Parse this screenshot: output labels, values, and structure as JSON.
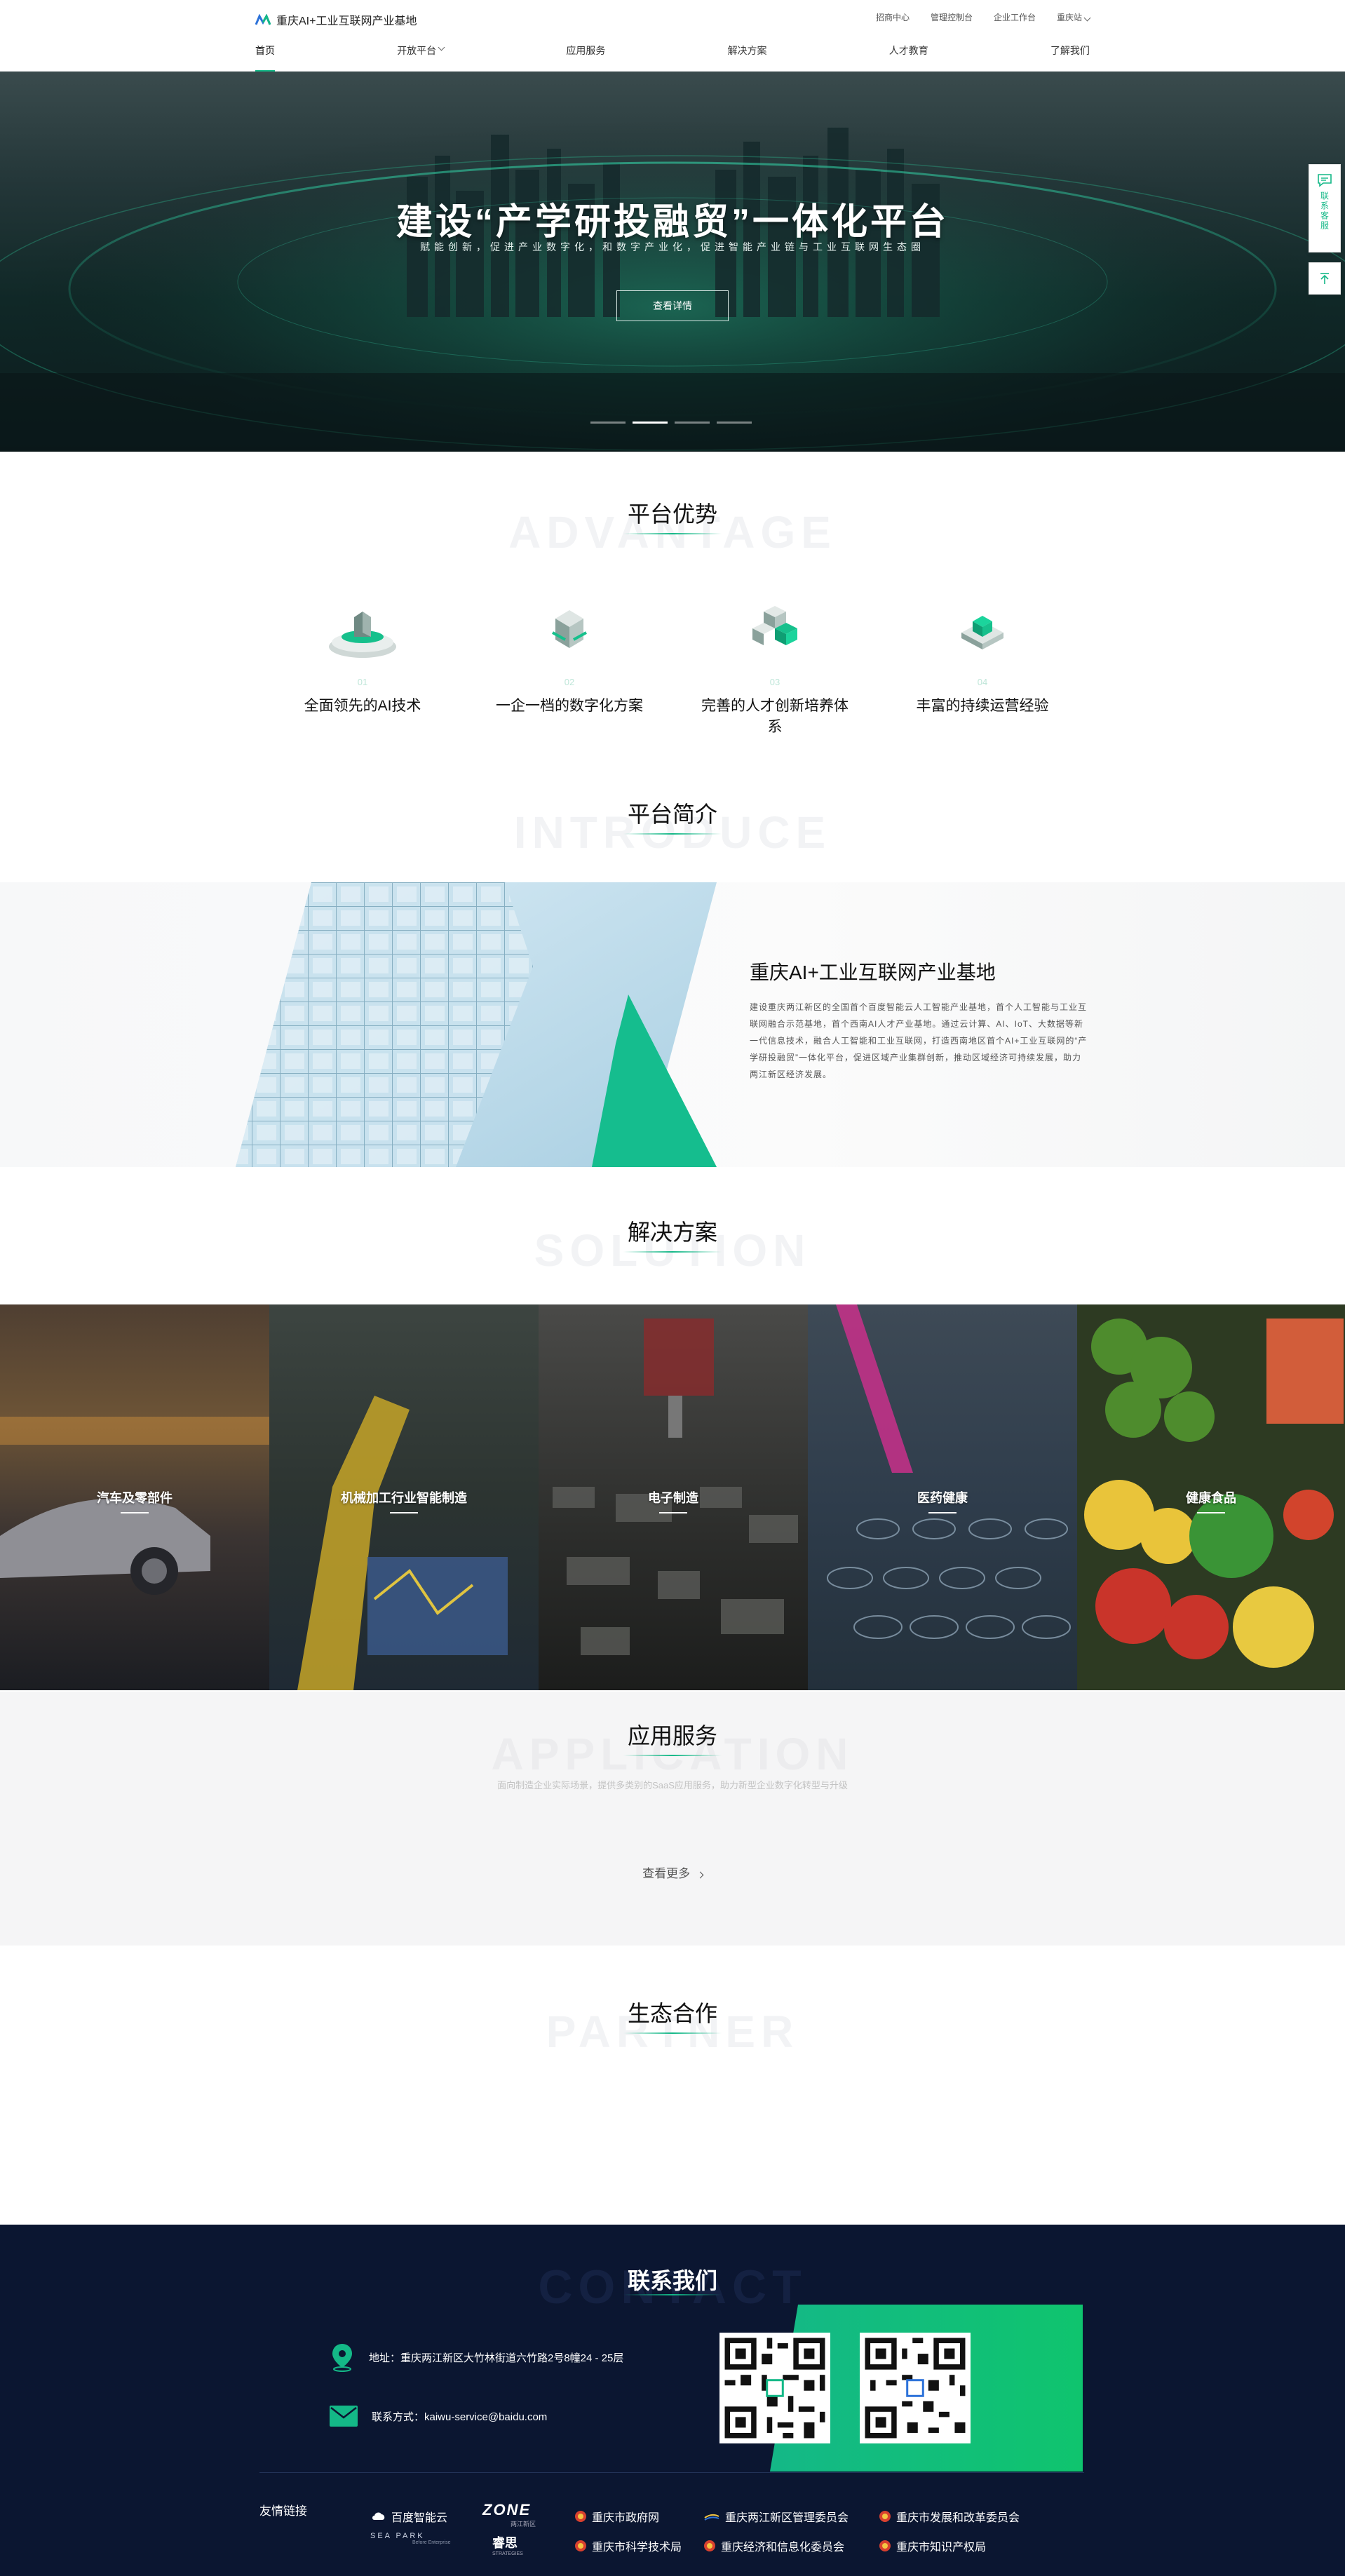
{
  "header": {
    "logo_text": "重庆AI+工业互联网产业基地",
    "top_links": [
      "招商中心",
      "管理控制台",
      "企业工作台",
      "重庆站"
    ],
    "nav": [
      {
        "label": "首页",
        "active": true
      },
      {
        "label": "开放平台",
        "has_dropdown": true
      },
      {
        "label": "应用服务"
      },
      {
        "label": "解决方案"
      },
      {
        "label": "人才教育"
      },
      {
        "label": "了解我们"
      }
    ]
  },
  "hero": {
    "title": "建设“产学研投融贸”一体化平台",
    "subtitle": "赋能创新，促进产业数字化，和数字产业化，促进智能产业链与工业互联网生态圈",
    "button": "查看详情",
    "slides": 4,
    "active_slide": 2
  },
  "float": {
    "service_label": "联系客服",
    "icons": [
      "chat-icon",
      "back-to-top-icon"
    ]
  },
  "advantage": {
    "title": "平台优势",
    "bg_text": "ADVANTAGE",
    "items": [
      {
        "num": "01",
        "label": "全面领先的AI技术"
      },
      {
        "num": "02",
        "label": "一企一档的数字化方案"
      },
      {
        "num": "03",
        "label": "完善的人才创新培养体系"
      },
      {
        "num": "04",
        "label": "丰富的持续运营经验"
      }
    ]
  },
  "intro": {
    "title": "平台简介",
    "bg_text": "INTRODUCE",
    "heading": "重庆AI+工业互联网产业基地",
    "text": "建设重庆两江新区的全国首个百度智能云人工智能产业基地，首个人工智能与工业互联网融合示范基地，首个西南AI人才产业基地。通过云计算、AI、IoT、大数据等新一代信息技术，融合人工智能和工业互联网，打造西南地区首个AI+工业互联网的“产学研投融贸”一体化平台，促进区域产业集群创新，推动区域经济可持续发展，助力两江新区经济发展。"
  },
  "solution": {
    "title": "解决方案",
    "bg_text": "SOLUTION",
    "items": [
      "汽车及零部件",
      "机械加工行业智能制造",
      "电子制造",
      "医药健康",
      "健康食品"
    ]
  },
  "application": {
    "title": "应用服务",
    "bg_text": "APPLICATION",
    "subtitle": "面向制造企业实际场景，提供多类别的SaaS应用服务，助力新型企业数字化转型与升级",
    "more": "查看更多"
  },
  "partner": {
    "title": "生态合作",
    "bg_text": "PARTNER"
  },
  "contact": {
    "title": "联系我们",
    "bg_text": "CONTACT",
    "address": "地址：重庆两江新区大竹林街道六竹路2号8幢24 - 25层",
    "email": "联系方式：kaiwu-service@baidu.com"
  },
  "friend_links": {
    "title": "友情链接",
    "items": [
      "百度智能云",
      "ZONE",
      "重庆市政府网",
      "重庆两江新区管理委员会",
      "重庆市发展和改革委员会",
      "SEA PARK",
      "睿思",
      "重庆市科学技术局",
      "重庆经济和信息化委员会",
      "重庆市知识产权局"
    ],
    "zone_sub": "两江新区",
    "seapark_sub": "Before Enterprise",
    "ruisi_sub": "STRATEGIES"
  },
  "colors": {
    "accent": "#14b887",
    "footer_bg": "#0b1631",
    "hero_dark": "#0b1b1d"
  }
}
